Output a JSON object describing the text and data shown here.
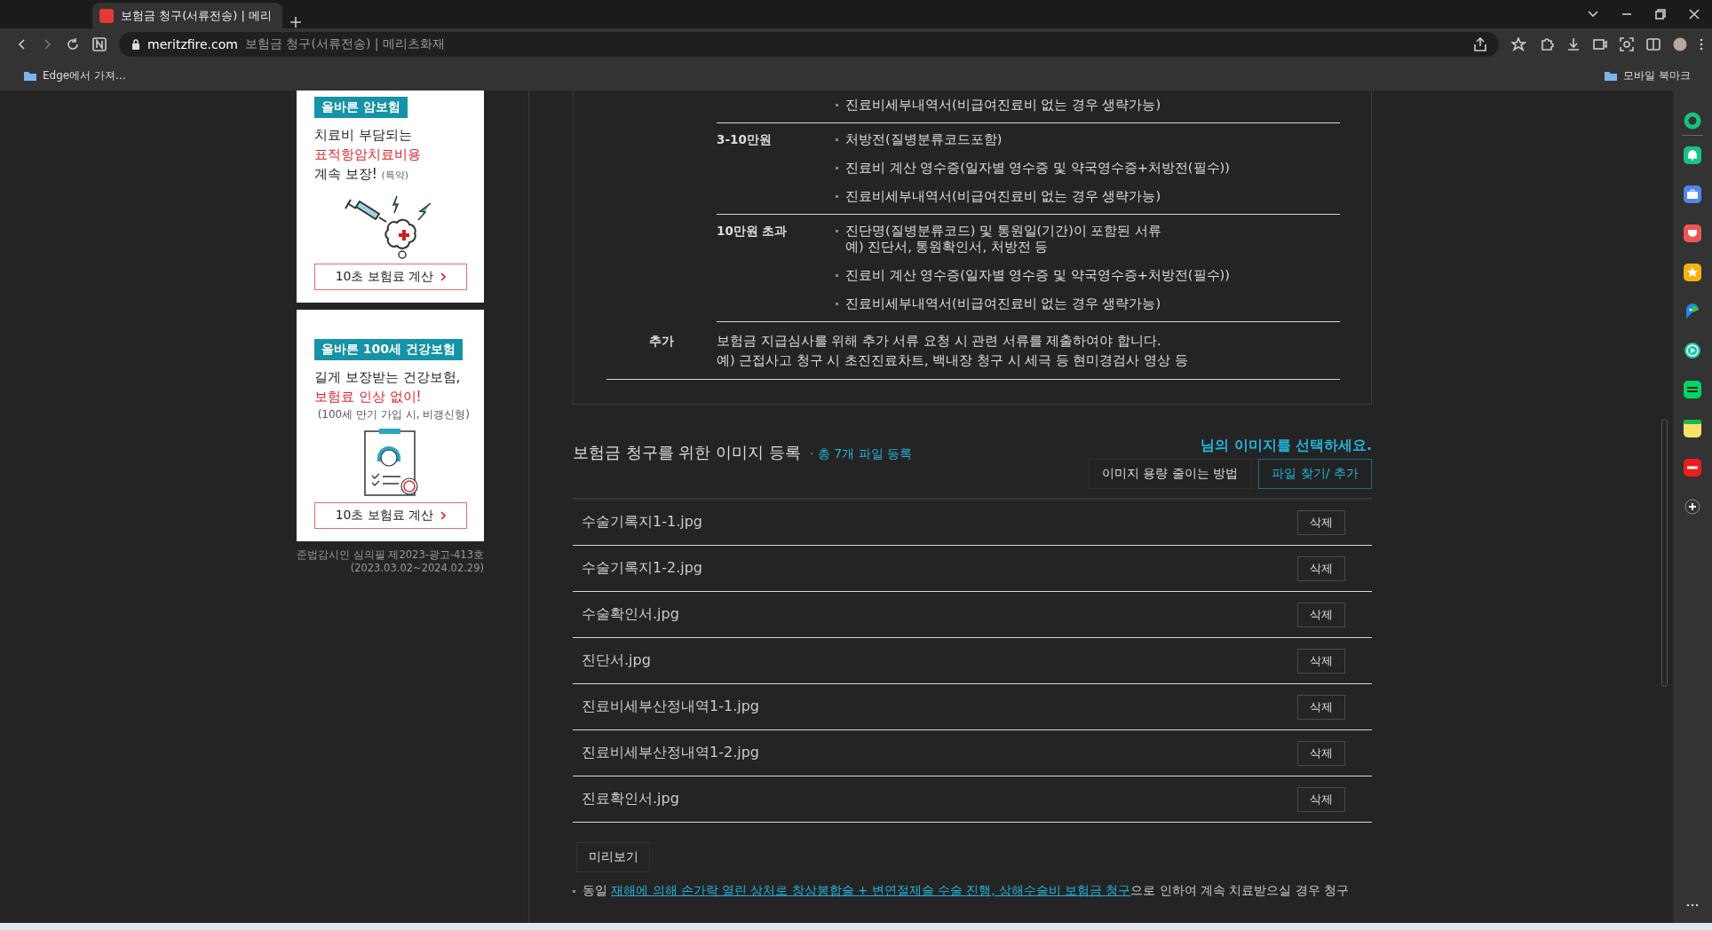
{
  "browser": {
    "tab": {
      "title": "보험금 청구(서류전송) | 메리",
      "selected": true
    },
    "url_domain": "meritzfire.com",
    "url_title": "보험금 청구(서류전송) | 메리츠화재",
    "bookmark_left": "Edge에서 가져...",
    "bookmark_right": "모바일 북마크"
  },
  "ads": [
    {
      "badge": "올바른 암보험",
      "lines": [
        {
          "text": "치료비 부담되는",
          "kind": "normal"
        },
        {
          "text": "표적항암치료비용",
          "kind": "highlight"
        },
        {
          "text": "계속 보장!",
          "kind": "normal",
          "suffix": "(특약)"
        }
      ],
      "kind": "syringe",
      "button": "10초 보험료 계산"
    },
    {
      "badge": "올바른 100세 건강보험",
      "lines": [
        {
          "text": "길게 보장받는 건강보험,",
          "kind": "normal"
        },
        {
          "text": "보험료 인상 없이!",
          "kind": "highlight"
        },
        {
          "text": "(100세 만기 가입 시, 비갱신형)",
          "kind": "note"
        }
      ],
      "kind": "clipboard",
      "button": "10초 보험료 계산"
    }
  ],
  "ad_notice": [
    "준법감시인 심의필 제2023-광고-413호",
    "(2023.03.02~2024.02.29)"
  ],
  "documents": {
    "groups": [
      {
        "items": [
          "진료비세부내역서(비급여진료비 없는 경우 생략가능)"
        ]
      },
      {
        "amount": "3-10만원",
        "items": [
          "처방전(질병분류코드포함)",
          "진료비 계산 영수증(일자별 영수증 및 약국영수증+처방전(필수))",
          "진료비세부내역서(비급여진료비 없는 경우 생략가능)"
        ]
      },
      {
        "amount": "10만원 초과",
        "items": [
          "진단명(질병분류코드) 및 통원일(기간)이 포함된 서류\n예) 진단서, 통원확인서, 처방전 등",
          "진료비 계산 영수증(일자별 영수증 및 약국영수증+처방전(필수))",
          "진료비세부내역서(비급여진료비 없는 경우 생략가능)"
        ]
      }
    ],
    "extra": {
      "label": "추가",
      "lines": [
        "보험금 지급심사를 위해 추가 서류 요청 시 관련 서류를 제출하여야 합니다.",
        "예) 근접사고 청구 시 초진진료차트, 백내장 청구 시 세극 등 현미경검사 영상 등"
      ]
    }
  },
  "upload": {
    "title": "보험금 청구를 위한 이미지 등록",
    "count": "· 총 7개 파일 등록",
    "prompt": "님의 이미지를 선택하세요.",
    "buttons": [
      {
        "label": "이미지 용량 줄이는 방법",
        "kind": "plain"
      },
      {
        "label": "파일 찾기/ 추가",
        "kind": "primary"
      }
    ],
    "files": [
      {
        "name": "수술기록지1-1.jpg",
        "action": "삭제"
      },
      {
        "name": "수술기록지1-2.jpg",
        "action": "삭제"
      },
      {
        "name": "수술확인서.jpg",
        "action": "삭제"
      },
      {
        "name": "진단서.jpg",
        "action": "삭제"
      },
      {
        "name": "진료비세부산정내역1-1.jpg",
        "action": "삭제"
      },
      {
        "name": "진료비세부산정내역1-2.jpg",
        "action": "삭제"
      },
      {
        "name": "진료확인서.jpg",
        "action": "삭제"
      }
    ],
    "preview": "미리보기",
    "footnote": [
      {
        "text": "동일 ",
        "kind": "plain"
      },
      {
        "text": "재해에 의해 손가락 열린 상처로 창상봉합술 + 변연절제술 수술 진행, 상해수술비 보험금 청구",
        "kind": "link"
      },
      {
        "text": "으로 인하여 계속 치료받으실 경우 청구",
        "kind": "plain"
      }
    ]
  }
}
